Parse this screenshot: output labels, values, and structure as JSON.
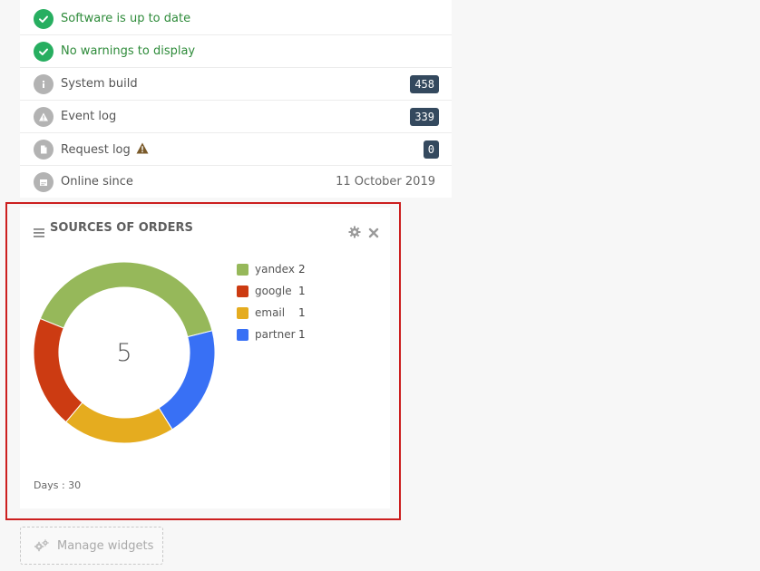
{
  "status": {
    "items": [
      {
        "icon": "check-icon",
        "label": "Software is up to date",
        "kind": "ok"
      },
      {
        "icon": "check-icon",
        "label": "No warnings to display",
        "kind": "ok"
      },
      {
        "icon": "info-icon",
        "label": "System build",
        "badge": "458"
      },
      {
        "icon": "warning-icon",
        "label": "Event log",
        "badge": "339"
      },
      {
        "icon": "document-icon",
        "label": "Request log",
        "badge": "0",
        "warning": "warning-triangle-icon"
      },
      {
        "icon": "calendar-icon",
        "label": "Online since",
        "value": "11 October 2019"
      }
    ]
  },
  "widget": {
    "title": "SOURCES OF ORDERS",
    "total": "5",
    "footer": "Days : 30",
    "legend": [
      {
        "name": "yandex",
        "value": "2"
      },
      {
        "name": "google",
        "value": "1"
      },
      {
        "name": "email",
        "value": "1"
      },
      {
        "name": "partner",
        "value": "1"
      }
    ]
  },
  "chart_data": {
    "type": "pie",
    "title": "SOURCES OF ORDERS",
    "categories": [
      "yandex",
      "google",
      "email",
      "partner"
    ],
    "values": [
      2,
      1,
      1,
      1
    ],
    "colors": [
      "#96b85a",
      "#cc3b12",
      "#e5ac1f",
      "#3870f5"
    ],
    "center_label": "5",
    "legend_position": "right"
  },
  "colors": {
    "ok": "#27ae60",
    "badge": "#34495e",
    "highlight_border": "#cc1f1f"
  },
  "manage": {
    "label": "Manage widgets",
    "icon": "gears-icon"
  }
}
